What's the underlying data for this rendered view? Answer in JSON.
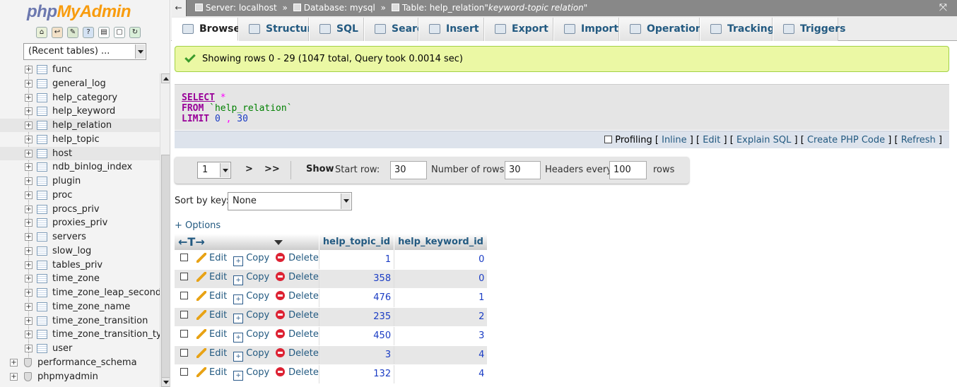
{
  "app": {
    "logo_a": "php",
    "logo_b": "MyAdmin",
    "recent_tables": "(Recent tables) ..."
  },
  "sidebar": {
    "items": [
      {
        "label": "func",
        "type": "table"
      },
      {
        "label": "general_log",
        "type": "table"
      },
      {
        "label": "help_category",
        "type": "table"
      },
      {
        "label": "help_keyword",
        "type": "table"
      },
      {
        "label": "help_relation",
        "type": "table",
        "selected": true
      },
      {
        "label": "help_topic",
        "type": "table"
      },
      {
        "label": "host",
        "type": "table",
        "selected": true
      },
      {
        "label": "ndb_binlog_index",
        "type": "table"
      },
      {
        "label": "plugin",
        "type": "table"
      },
      {
        "label": "proc",
        "type": "table"
      },
      {
        "label": "procs_priv",
        "type": "table"
      },
      {
        "label": "proxies_priv",
        "type": "table"
      },
      {
        "label": "servers",
        "type": "table"
      },
      {
        "label": "slow_log",
        "type": "table"
      },
      {
        "label": "tables_priv",
        "type": "table"
      },
      {
        "label": "time_zone",
        "type": "table"
      },
      {
        "label": "time_zone_leap_second",
        "type": "table"
      },
      {
        "label": "time_zone_name",
        "type": "table"
      },
      {
        "label": "time_zone_transition",
        "type": "table"
      },
      {
        "label": "time_zone_transition_type",
        "type": "table"
      },
      {
        "label": "user",
        "type": "table"
      },
      {
        "label": "performance_schema",
        "type": "db"
      },
      {
        "label": "phpmyadmin",
        "type": "db"
      }
    ]
  },
  "breadcrumb": {
    "server": "Server: localhost",
    "database": "Database: mysql",
    "table": "Table: help_relation",
    "comment": "\"keyword-topic relation\"",
    "sep": "»"
  },
  "tabs": [
    {
      "label": "Browse",
      "icon": "browse-icon"
    },
    {
      "label": "Structure",
      "icon": "structure-icon"
    },
    {
      "label": "SQL",
      "icon": "sql-icon"
    },
    {
      "label": "Search",
      "icon": "search-icon"
    },
    {
      "label": "Insert",
      "icon": "insert-icon"
    },
    {
      "label": "Export",
      "icon": "export-icon"
    },
    {
      "label": "Import",
      "icon": "import-icon"
    },
    {
      "label": "Operations",
      "icon": "operations-icon"
    },
    {
      "label": "Tracking",
      "icon": "tracking-icon"
    },
    {
      "label": "Triggers",
      "icon": "triggers-icon"
    }
  ],
  "message": "Showing rows 0 - 29 (1047 total, Query took 0.0014 sec)",
  "sql": {
    "select": "SELECT",
    "star": "*",
    "from": "FROM",
    "table": "`help_relation`",
    "limit": "LIMIT",
    "offset": "0",
    "comma": ",",
    "count": "30"
  },
  "sql_links": {
    "profiling": "Profiling",
    "inline": "Inline",
    "edit": "Edit",
    "explain": "Explain SQL",
    "php": "Create PHP Code",
    "refresh": "Refresh"
  },
  "nav": {
    "page": "1",
    "next": ">",
    "last": ">>",
    "show": "Show",
    "start_row_label": "Start row:",
    "start_row": "30",
    "num_rows_label": "Number of rows:",
    "num_rows": "30",
    "headers_label": "Headers every",
    "headers": "100",
    "rows": "rows"
  },
  "sort": {
    "label": "Sort by key:",
    "value": "None"
  },
  "options": "+ Options",
  "grid": {
    "col_handle": "←T→",
    "columns": [
      "help_topic_id",
      "help_keyword_id"
    ],
    "actions": {
      "edit": "Edit",
      "copy": "Copy",
      "delete": "Delete"
    },
    "rows": [
      [
        "1",
        "0"
      ],
      [
        "358",
        "0"
      ],
      [
        "476",
        "1"
      ],
      [
        "235",
        "2"
      ],
      [
        "450",
        "3"
      ],
      [
        "3",
        "4"
      ],
      [
        "132",
        "4"
      ]
    ]
  }
}
